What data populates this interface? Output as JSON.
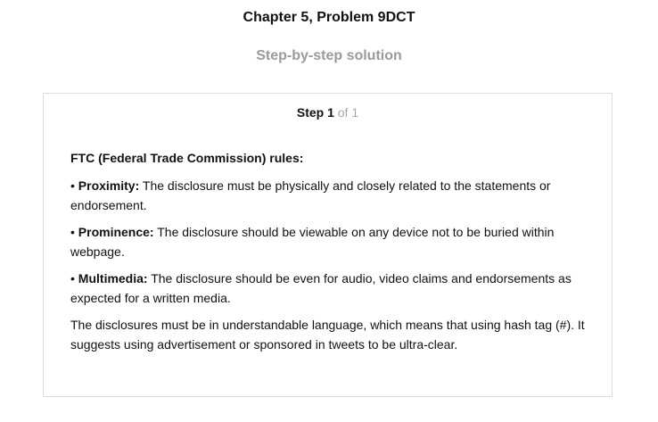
{
  "header": {
    "chapter_title": "Chapter 5, Problem 9DCT",
    "subtitle": "Step-by-step solution"
  },
  "step": {
    "label": "Step 1",
    "of_text": "of 1"
  },
  "content": {
    "heading": "FTC (Federal Trade Commission) rules:",
    "bullet": "•",
    "rules": [
      {
        "name": "Proximity:",
        "text": "The disclosure must be physically and closely related to the statements or endorsement."
      },
      {
        "name": "Prominence:",
        "text": "The disclosure should be viewable on any device not to be buried within webpage."
      },
      {
        "name": "Multimedia:",
        "text": "The disclosure should be even for audio, video claims and endorsements as expected for a written media."
      }
    ],
    "closing": "The disclosures must be in understandable language, which means that using hash tag (#). It suggests using advertisement or sponsored in tweets to be ultra-clear."
  }
}
